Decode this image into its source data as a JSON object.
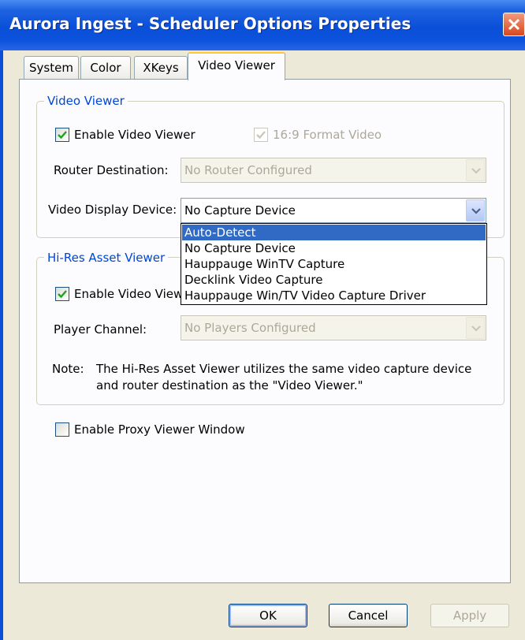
{
  "window": {
    "title": "Aurora Ingest - Scheduler Options Properties",
    "close_icon": "close-icon",
    "accent_color": "#0a4fd8"
  },
  "tabs": [
    {
      "label": "System",
      "active": false
    },
    {
      "label": "Color",
      "active": false
    },
    {
      "label": "XKeys",
      "active": false
    },
    {
      "label": "Video Viewer",
      "active": true
    }
  ],
  "video_viewer": {
    "legend": "Video Viewer",
    "enable_label": "Enable Video Viewer",
    "enable_checked": true,
    "format_label": "16:9 Format Video",
    "format_checked": true,
    "format_enabled": false,
    "router_label": "Router Destination:",
    "router_value": "No Router Configured",
    "display_label": "Video Display Device:",
    "display_value": "No Capture Device"
  },
  "display_dropdown": {
    "options": [
      "Auto-Detect",
      "No Capture Device",
      "Hauppauge WinTV Capture",
      "Decklink Video Capture",
      "Hauppauge Win/TV Video Capture Driver"
    ],
    "highlighted": "Auto-Detect"
  },
  "hires": {
    "legend": "Hi-Res Asset Viewer",
    "enable_label": "Enable Video Viewer",
    "enable_checked": true,
    "player_label": "Player Channel:",
    "player_value": "No Players Configured",
    "note_prefix": "Note:",
    "note_line1": "The Hi-Res Asset Viewer utilizes the same video capture device",
    "note_line2": "and router destination as the \"Video Viewer.\""
  },
  "proxy": {
    "label": "Enable Proxy Viewer Window",
    "checked": false
  },
  "buttons": {
    "ok": "OK",
    "cancel": "Cancel",
    "apply": "Apply"
  }
}
